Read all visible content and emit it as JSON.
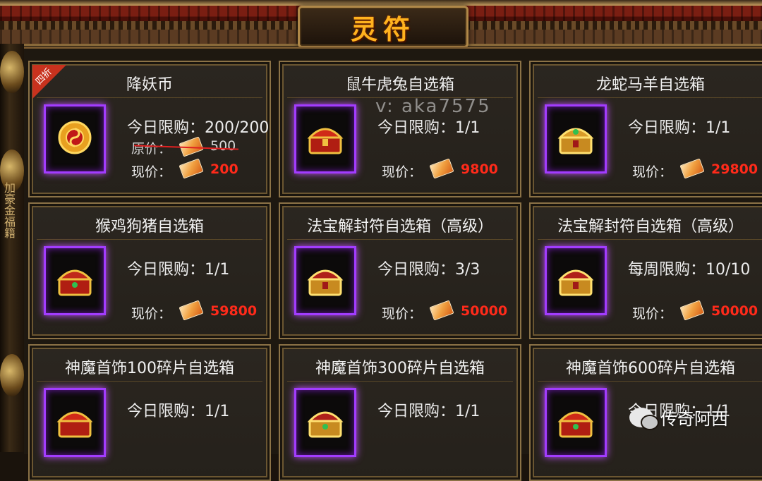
{
  "header": {
    "title": "灵符"
  },
  "watermark": {
    "top": "v: aka7575",
    "bottom": "传奇阿西"
  },
  "side_scroll": "加豪金福籍",
  "labels": {
    "current_price": "现价：",
    "original_price": "原价："
  },
  "colors": {
    "accent": "#ffb21e",
    "price": "#ff2a1a",
    "frame": "#a23cff"
  },
  "cards": [
    {
      "name": "降妖币",
      "limit": "今日限购：200/200",
      "old_price": "500",
      "price": "200",
      "discount": "四折",
      "icon": "coin-icon"
    },
    {
      "name": "鼠牛虎兔自选箱",
      "limit": "今日限购：1/1",
      "price": "9800",
      "icon": "chest-icon"
    },
    {
      "name": "龙蛇马羊自选箱",
      "limit": "今日限购：1/1",
      "price": "29800",
      "icon": "chest-icon"
    },
    {
      "name": "猴鸡狗猪自选箱",
      "limit": "今日限购：1/1",
      "price": "59800",
      "icon": "chest-icon"
    },
    {
      "name": "法宝解封符自选箱（高级）",
      "limit": "今日限购：3/3",
      "price": "50000",
      "icon": "chest-icon"
    },
    {
      "name": "法宝解封符自选箱（高级）",
      "limit": "每周限购：10/10",
      "price": "50000",
      "icon": "chest-icon"
    },
    {
      "name": "神魔首饰100碎片自选箱",
      "limit": "今日限购：1/1",
      "price": "",
      "icon": "chest-icon"
    },
    {
      "name": "神魔首饰300碎片自选箱",
      "limit": "今日限购：1/1",
      "price": "",
      "icon": "chest-icon"
    },
    {
      "name": "神魔首饰600碎片自选箱",
      "limit": "今日限购：1/1",
      "price": "",
      "icon": "chest-icon"
    }
  ]
}
